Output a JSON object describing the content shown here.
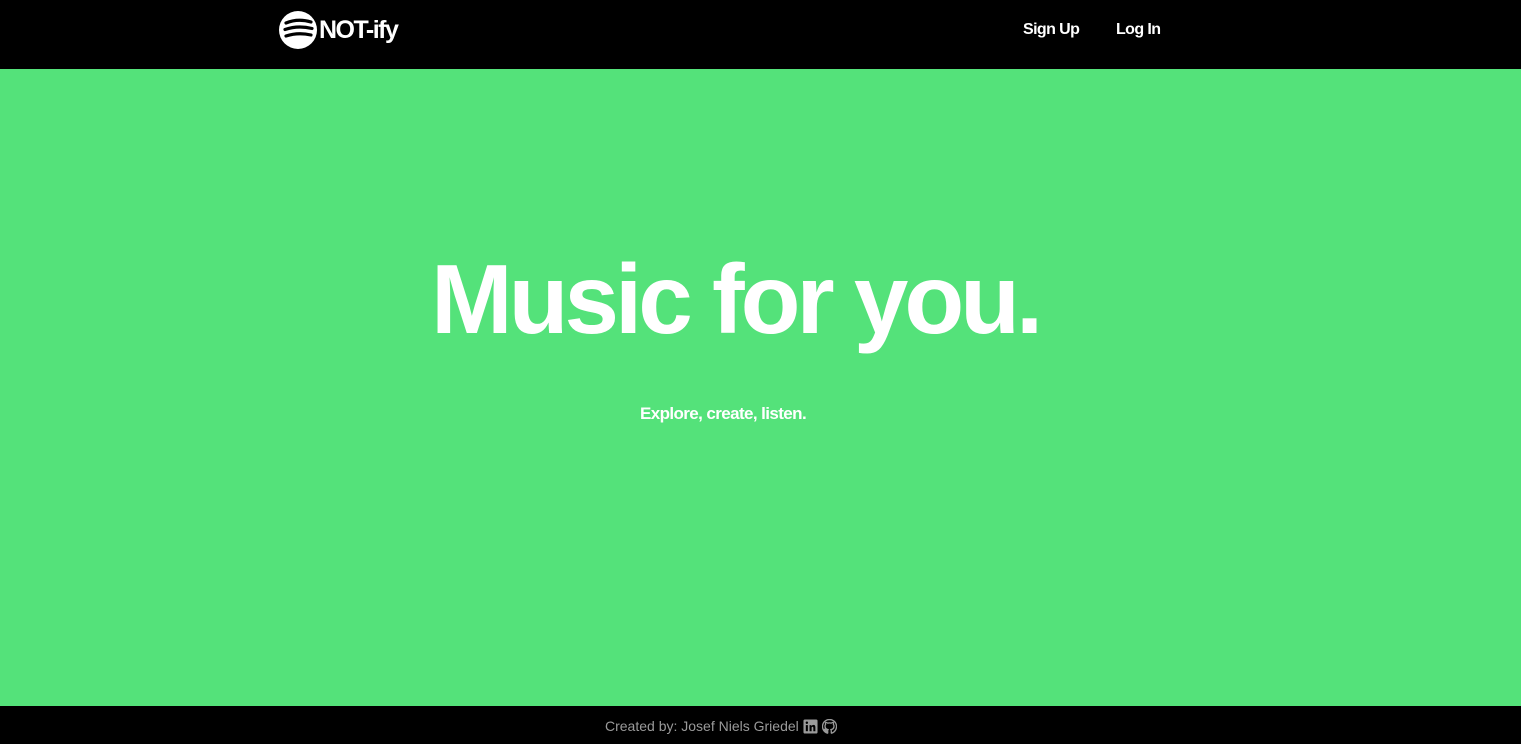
{
  "header": {
    "brand": "NOT-ify",
    "nav": {
      "signup_label": "Sign Up",
      "login_label": "Log In"
    }
  },
  "hero": {
    "title": "Music for you.",
    "subtitle": "Explore, create, listen."
  },
  "footer": {
    "credit": "Created by: Josef Niels Griedel",
    "icons": [
      "linkedin-icon",
      "github-icon"
    ]
  },
  "colors": {
    "background": "#54e27a",
    "bars": "#000000",
    "text": "#ffffff",
    "footer_text": "#9a9a9a"
  }
}
